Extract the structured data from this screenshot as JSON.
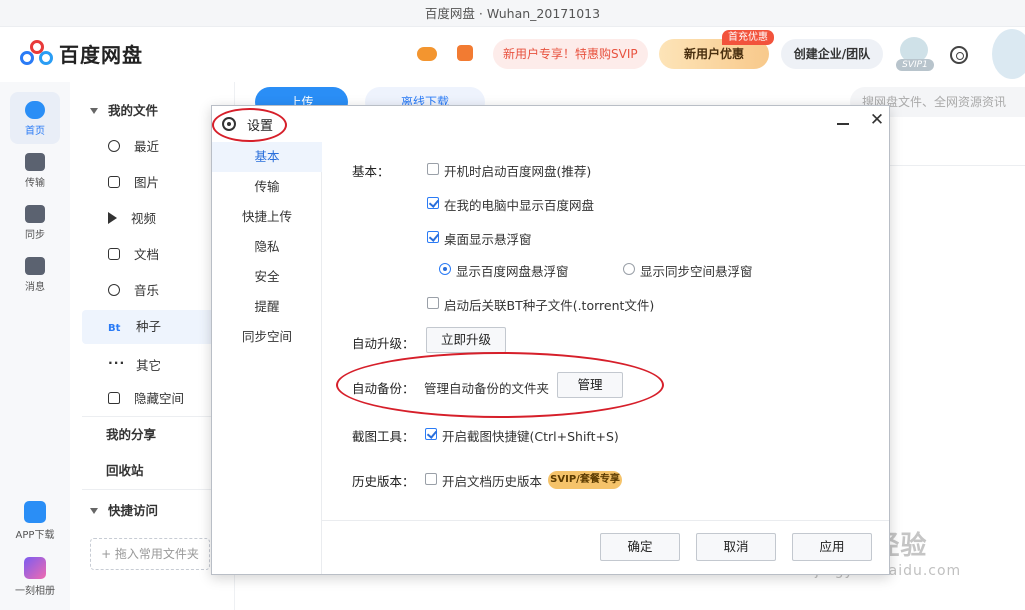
{
  "window": {
    "title": "百度网盘 · Wuhan_20171013"
  },
  "header": {
    "logo_text": "百度网盘",
    "promo": "新用户专享！特惠购SVIP",
    "new_user": "新用户优惠",
    "new_user_badge": "首充优惠",
    "team": "创建企业/团队",
    "svip_tag": "SVIP1"
  },
  "leftnav": {
    "home": "首页",
    "transfer": "传输",
    "sync": "同步",
    "messages": "消息",
    "app_download": "APP下载",
    "album": "一刻相册"
  },
  "sidebar": {
    "my_files": "我的文件",
    "recent": "最近",
    "images": "图片",
    "videos": "视频",
    "docs": "文档",
    "music": "音乐",
    "seeds": "种子",
    "bt": "Bt",
    "others": "其它",
    "hidden_space": "隐藏空间",
    "my_shares": "我的分享",
    "recycle": "回收站",
    "quick_access": "快捷访问",
    "drop_hint": "+ 拖入常用文件夹"
  },
  "main": {
    "upload": "上传",
    "offline": "离线下载",
    "search_placeholder": "搜网盘文件、全网资源资讯"
  },
  "dialog": {
    "title": "设置",
    "nav": [
      "基本",
      "传输",
      "快捷上传",
      "隐私",
      "安全",
      "提醒",
      "同步空间"
    ],
    "basic_label": "基本：",
    "opt_autostart": "开机时启动百度网盘(推荐)",
    "opt_show_in_pc": "在我的电脑中显示百度网盘",
    "opt_float": "桌面显示悬浮窗",
    "radio_netdisk_float": "显示百度网盘悬浮窗",
    "radio_sync_float": "显示同步空间悬浮窗",
    "opt_bt": "启动后关联BT种子文件(.torrent文件)",
    "upgrade_label": "自动升级：",
    "upgrade_btn": "立即升级",
    "backup_label": "自动备份：",
    "backup_text": "管理自动备份的文件夹",
    "backup_btn": "管理",
    "screenshot_label": "截图工具：",
    "screenshot_opt": "开启截图快捷键(Ctrl+Shift+S)",
    "history_label": "历史版本：",
    "history_opt": "开启文档历史版本",
    "history_tag": "SVIP/套餐专享",
    "ok": "确定",
    "cancel": "取消",
    "apply": "应用"
  },
  "watermark": {
    "brand": "Baidu经验",
    "url": "jingyan.baidu.com"
  }
}
